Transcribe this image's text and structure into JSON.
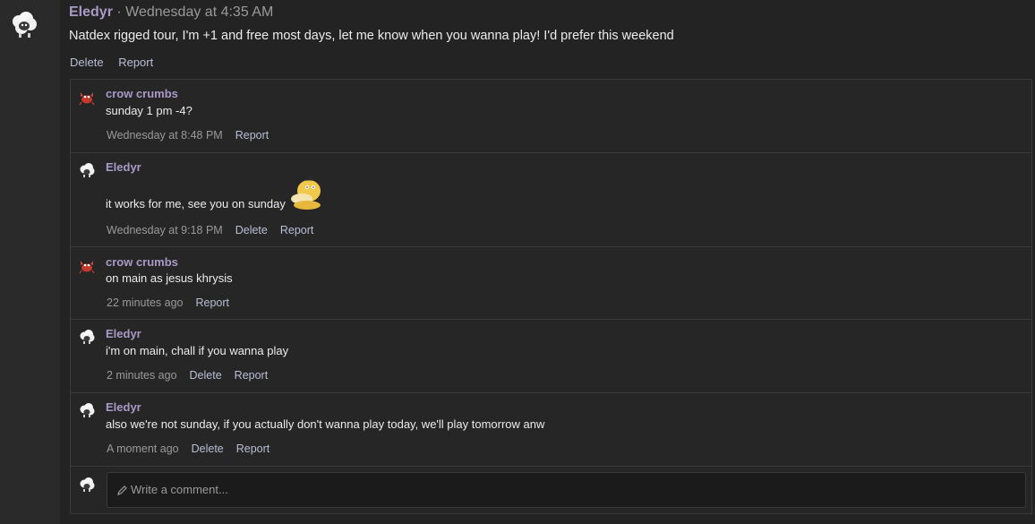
{
  "post": {
    "author": "Eledyr",
    "timestamp": " · Wednesday at 4:35 AM",
    "body": "Natdex rigged tour, I'm +1 and free most days, let me know when you wanna play! I'd prefer this weekend",
    "actions": {
      "delete": "Delete",
      "report": "Report"
    }
  },
  "comments": [
    {
      "author": "crow crumbs",
      "text": "sunday 1 pm -4?",
      "time": "Wednesday at 8:48 PM",
      "report": "Report",
      "avatar_icon": "crab-icon"
    },
    {
      "author": "Eledyr",
      "text": "it works for me, see you on sunday",
      "time": "Wednesday at 9:18 PM",
      "delete": "Delete",
      "report": "Report",
      "avatar_icon": "sheep-icon"
    },
    {
      "author": "crow crumbs",
      "text": "on main as jesus khrysis",
      "time": "22 minutes ago",
      "report": "Report",
      "avatar_icon": "crab-icon"
    },
    {
      "author": "Eledyr",
      "text": "i'm on main, chall if you wanna play",
      "time": "2 minutes ago",
      "delete": "Delete",
      "report": "Report",
      "avatar_icon": "sheep-icon"
    },
    {
      "author": "Eledyr",
      "text": "also we're not sunday, if you actually don't wanna play today, we'll play tomorrow anw",
      "time": "A moment ago",
      "delete": "Delete",
      "report": "Report",
      "avatar_icon": "sheep-icon"
    }
  ],
  "composer": {
    "placeholder": "Write a comment...",
    "icon": "pencil-icon"
  },
  "colors": {
    "author": "#a99ac7",
    "link": "#b9bfd4",
    "muted": "#9a9a9a",
    "background": "#232323"
  }
}
